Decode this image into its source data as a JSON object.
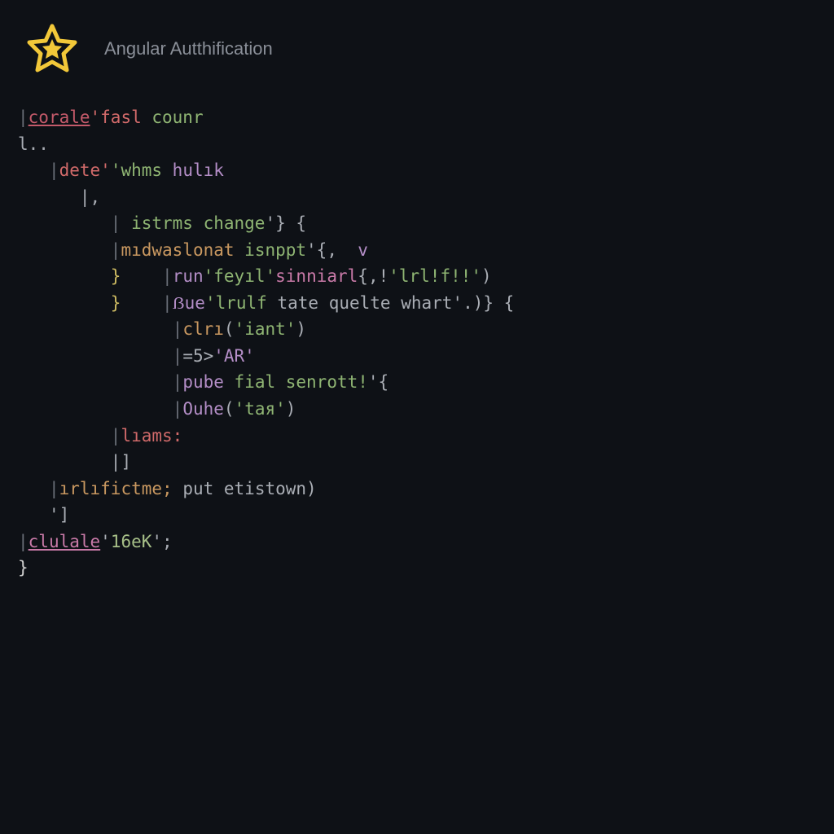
{
  "header": {
    "title": "Angular Autthification"
  },
  "code": {
    "lines": [
      {
        "indent": 0,
        "tokens": [
          {
            "t": "|",
            "c": "tok-pipe"
          },
          {
            "t": "corale",
            "c": "tok-red-u"
          },
          {
            "t": "'fasl ",
            "c": "tok-red"
          },
          {
            "t": "counr",
            "c": "tok-green"
          }
        ]
      },
      {
        "indent": 0,
        "tokens": [
          {
            "t": "l..",
            "c": "tok-gray"
          }
        ]
      },
      {
        "indent": 1,
        "tokens": [
          {
            "t": "|",
            "c": "tok-pipe"
          },
          {
            "t": "dete'",
            "c": "tok-red"
          },
          {
            "t": "'whms ",
            "c": "tok-green"
          },
          {
            "t": "hulık",
            "c": "tok-purple"
          }
        ]
      },
      {
        "indent": 2,
        "tokens": [
          {
            "t": "|,",
            "c": "tok-gray"
          }
        ]
      },
      {
        "indent": 3,
        "tokens": [
          {
            "t": "| ",
            "c": "tok-pipe"
          },
          {
            "t": "istrms change",
            "c": "tok-green"
          },
          {
            "t": "'} {",
            "c": "tok-gray"
          }
        ]
      },
      {
        "indent": 3,
        "tokens": [
          {
            "t": "|",
            "c": "tok-pipe"
          },
          {
            "t": "mıdwaslonat ",
            "c": "tok-orange"
          },
          {
            "t": "isnppt",
            "c": "tok-green"
          },
          {
            "t": "'{,  ",
            "c": "tok-gray"
          },
          {
            "t": "v",
            "c": "tok-purple"
          }
        ]
      },
      {
        "indent": 3,
        "tokens": [
          {
            "t": "}",
            "c": "tok-yellow"
          },
          {
            "t": "    ",
            "c": ""
          },
          {
            "t": "|",
            "c": "tok-pipe"
          },
          {
            "t": "run",
            "c": "tok-purple"
          },
          {
            "t": "'feyıl'",
            "c": "tok-green"
          },
          {
            "t": "sinniarl",
            "c": "tok-pink"
          },
          {
            "t": "{,!",
            "c": "tok-gray"
          },
          {
            "t": "'lrl!f!!'",
            "c": "tok-green"
          },
          {
            "t": ")",
            "c": "tok-gray"
          }
        ]
      },
      {
        "indent": 3,
        "tokens": [
          {
            "t": "}",
            "c": "tok-yellow"
          },
          {
            "t": "    ",
            "c": ""
          },
          {
            "t": "|",
            "c": "tok-pipe"
          },
          {
            "t": "ẞue",
            "c": "tok-purple"
          },
          {
            "t": "'lrulf ",
            "c": "tok-green"
          },
          {
            "t": "tate quelte whart'",
            "c": "tok-gray"
          },
          {
            "t": ".)} {",
            "c": "tok-gray"
          }
        ]
      },
      {
        "indent": 5,
        "tokens": [
          {
            "t": "|",
            "c": "tok-pipe"
          },
          {
            "t": "clrı",
            "c": "tok-orange"
          },
          {
            "t": "(",
            "c": "tok-gray"
          },
          {
            "t": "'iant'",
            "c": "tok-green"
          },
          {
            "t": ")",
            "c": "tok-gray"
          }
        ]
      },
      {
        "indent": 5,
        "tokens": [
          {
            "t": "|",
            "c": "tok-pipe"
          },
          {
            "t": "=5>",
            "c": "tok-gray"
          },
          {
            "t": "'AR'",
            "c": "tok-purple"
          }
        ]
      },
      {
        "indent": 5,
        "tokens": [
          {
            "t": "|",
            "c": "tok-pipe"
          },
          {
            "t": "pube ",
            "c": "tok-purple"
          },
          {
            "t": "fial senrott!",
            "c": "tok-green"
          },
          {
            "t": "'{",
            "c": "tok-gray"
          }
        ]
      },
      {
        "indent": 5,
        "tokens": [
          {
            "t": "|",
            "c": "tok-pipe"
          },
          {
            "t": "Ouhe",
            "c": "tok-purple"
          },
          {
            "t": "(",
            "c": "tok-gray"
          },
          {
            "t": "'taя'",
            "c": "tok-green"
          },
          {
            "t": ")",
            "c": "tok-gray"
          }
        ]
      },
      {
        "indent": 3,
        "tokens": [
          {
            "t": "|",
            "c": "tok-pipe"
          },
          {
            "t": "lıams:",
            "c": "tok-red"
          }
        ]
      },
      {
        "indent": 3,
        "tokens": [
          {
            "t": "|]",
            "c": "tok-gray"
          }
        ]
      },
      {
        "indent": 1,
        "tokens": [
          {
            "t": "|",
            "c": "tok-pipe"
          },
          {
            "t": "ırlıfictme; ",
            "c": "tok-orange"
          },
          {
            "t": "put etistown)",
            "c": "tok-gray"
          }
        ]
      },
      {
        "indent": 1,
        "tokens": [
          {
            "t": "']",
            "c": "tok-gray"
          }
        ]
      },
      {
        "indent": 0,
        "tokens": [
          {
            "t": "|",
            "c": "tok-pipe"
          },
          {
            "t": "clulale",
            "c": "tok-pink-u"
          },
          {
            "t": "'",
            "c": "tok-gray"
          },
          {
            "t": "16eK",
            "c": "tok-green-lt"
          },
          {
            "t": "';",
            "c": "tok-gray"
          }
        ]
      },
      {
        "indent": 0,
        "tokens": [
          {
            "t": "}",
            "c": "tok-white"
          }
        ]
      }
    ]
  }
}
